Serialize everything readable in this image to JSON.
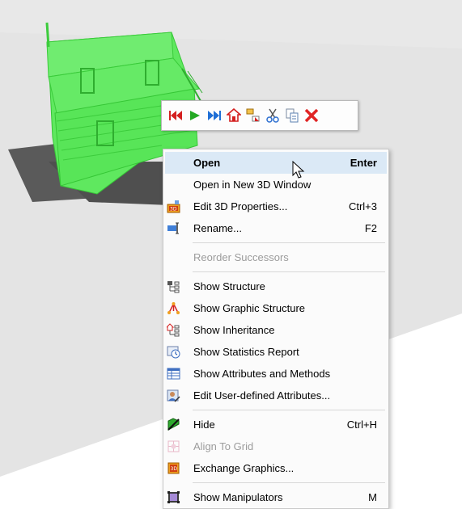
{
  "toolbar": {
    "buttons": [
      {
        "icon": "first-icon",
        "color": "#d42020"
      },
      {
        "icon": "play-icon",
        "color": "#23a823"
      },
      {
        "icon": "fast-forward-icon",
        "color": "#1f6fd6"
      },
      {
        "icon": "home-icon",
        "color": "#d42020"
      },
      {
        "icon": "graphic-structure-icon",
        "color": "#e0a020"
      },
      {
        "icon": "scissors-icon",
        "color": "#2d6fd0"
      },
      {
        "icon": "copy-icon",
        "color": "#5a7fb0"
      },
      {
        "icon": "delete-x-icon",
        "color": "#e02424"
      }
    ]
  },
  "menu": {
    "open": {
      "label": "Open",
      "shortcut": "Enter"
    },
    "open_new": {
      "label": "Open in New 3D Window"
    },
    "edit3d": {
      "label": "Edit 3D Properties...",
      "shortcut": "Ctrl+3"
    },
    "rename": {
      "label": "Rename...",
      "shortcut": "F2"
    },
    "reorder": {
      "label": "Reorder Successors"
    },
    "show_structure": {
      "label": "Show Structure"
    },
    "show_graphic_structure": {
      "label": "Show Graphic Structure"
    },
    "show_inheritance": {
      "label": "Show Inheritance"
    },
    "show_statistics": {
      "label": "Show Statistics Report"
    },
    "show_attributes": {
      "label": "Show Attributes and Methods"
    },
    "edit_user_attrs": {
      "label": "Edit User-defined Attributes..."
    },
    "hide": {
      "label": "Hide",
      "shortcut": "Ctrl+H"
    },
    "align": {
      "label": "Align To Grid"
    },
    "exchange": {
      "label": "Exchange Graphics..."
    },
    "manipulators": {
      "label": "Show Manipulators",
      "shortcut": "M"
    }
  },
  "colors": {
    "highlight": "#dbe9f6",
    "model_green": "#55e855",
    "ground": "#e3e3e3"
  }
}
